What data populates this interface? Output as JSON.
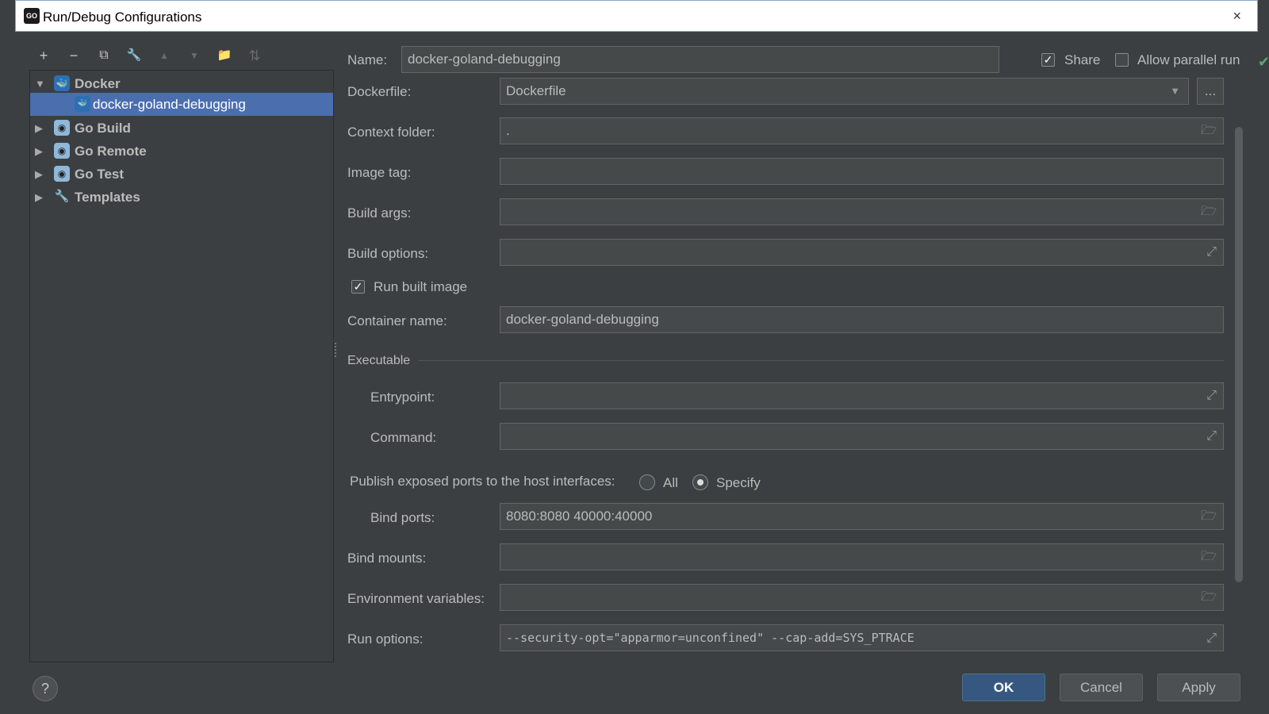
{
  "window": {
    "title": "Run/Debug Configurations",
    "logo_text": "GO",
    "close_glyph": "×"
  },
  "toolbar": {
    "add": "+",
    "remove": "−",
    "copy": "⧉",
    "edit_defaults": "🔧",
    "move_up": "▲",
    "move_down": "▼",
    "new_folder": "📁",
    "sort": "⇅"
  },
  "tree": {
    "items": [
      {
        "label": "Docker",
        "expanded": true,
        "icon": "docker-icon"
      },
      {
        "label": "docker-goland-debugging",
        "selected": true,
        "icon": "docker-config-icon"
      },
      {
        "label": "Go Build",
        "expanded": false,
        "icon": "gopher-icon"
      },
      {
        "label": "Go Remote",
        "expanded": false,
        "icon": "gopher-remote-icon"
      },
      {
        "label": "Go Test",
        "expanded": false,
        "icon": "gopher-test-icon"
      },
      {
        "label": "Templates",
        "expanded": false,
        "icon": "wrench-icon"
      }
    ],
    "arrow_expanded": "▼",
    "arrow_collapsed": "▶"
  },
  "header": {
    "name_label": "Name:",
    "name_value": "docker-goland-debugging",
    "share_label": "Share",
    "share_checked": true,
    "parallel_label": "Allow parallel run",
    "parallel_checked": false
  },
  "form": {
    "dockerfile_label": "Dockerfile:",
    "dockerfile_value": "Dockerfile",
    "dockerfile_browse": "...",
    "context_label": "Context folder:",
    "context_value": ".",
    "image_tag_label": "Image tag:",
    "image_tag_value": "",
    "build_args_label": "Build args:",
    "build_args_value": "",
    "build_options_label": "Build options:",
    "build_options_value": "",
    "run_built_label": "Run built image",
    "run_built_checked": true,
    "container_label": "Container name:",
    "container_value": "docker-goland-debugging",
    "executable_section": "Executable",
    "entrypoint_label": "Entrypoint:",
    "entrypoint_value": "",
    "command_label": "Command:",
    "command_value": "",
    "publish_label": "Publish exposed ports to the host interfaces:",
    "publish_all": "All",
    "publish_specify": "Specify",
    "publish_selected": "Specify",
    "bind_ports_label": "Bind ports:",
    "bind_ports_value": "8080:8080 40000:40000",
    "bind_mounts_label": "Bind mounts:",
    "bind_mounts_value": "",
    "env_label": "Environment variables:",
    "env_value": "",
    "run_options_label": "Run options:",
    "run_options_value": "--security-opt=\"apparmor=unconfined\" --cap-add=SYS_PTRACE"
  },
  "footer": {
    "help": "?",
    "ok": "OK",
    "cancel": "Cancel",
    "apply": "Apply"
  },
  "colors": {
    "background": "#3c3f41",
    "selection": "#4b6eaf",
    "field": "#45494a",
    "primary_button": "#365880"
  }
}
